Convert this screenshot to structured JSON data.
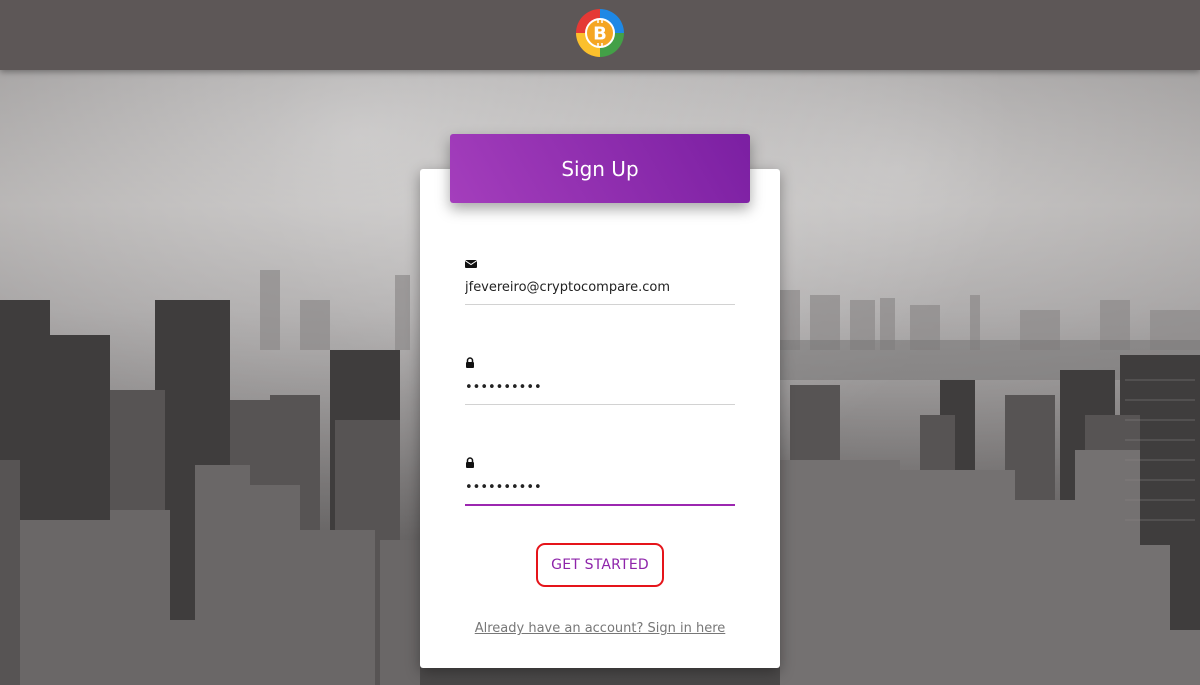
{
  "header": {
    "logo_icon": "bitcoin-logo-icon"
  },
  "card": {
    "title": "Sign Up",
    "email": {
      "icon": "envelope-icon",
      "value": "jfevereiro@cryptocompare.com"
    },
    "password": {
      "icon": "lock-icon",
      "value": "••••••••••"
    },
    "confirm_password": {
      "icon": "lock-icon",
      "value": "••••••••••"
    },
    "submit_label": "GET STARTED",
    "signin_link": "Already have an account? Sign in here"
  },
  "colors": {
    "accent": "#9c27b0",
    "header_gradient_start": "#a43ebc",
    "header_gradient_end": "#7b1fa2",
    "topbar": "#5d5757",
    "highlight_outline": "#e5141a"
  }
}
